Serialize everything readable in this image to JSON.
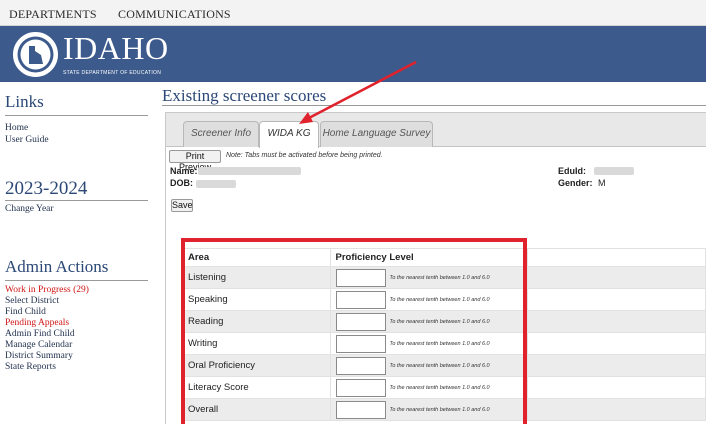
{
  "topnav": {
    "items": [
      "DEPARTMENTS",
      "COMMUNICATIONS"
    ]
  },
  "banner": {
    "brand": "IDAHO",
    "subtitle": "STATE DEPARTMENT OF EDUCATION"
  },
  "sidebar": {
    "links_heading": "Links",
    "links": [
      "Home",
      "User Guide"
    ],
    "year": "2023-2024",
    "change_year": "Change Year",
    "admin_heading": "Admin Actions",
    "admin_items": [
      {
        "label": "Work in Progress (29)",
        "color": "#d01515"
      },
      {
        "label": "Select District",
        "color": "#22324f"
      },
      {
        "label": "Find Child",
        "color": "#22324f"
      },
      {
        "label": "Pending Appeals",
        "color": "#d01515"
      },
      {
        "label": "Admin Find Child",
        "color": "#22324f"
      },
      {
        "label": "Manage Calendar",
        "color": "#22324f"
      },
      {
        "label": "District Summary",
        "color": "#22324f"
      },
      {
        "label": "State Reports",
        "color": "#22324f"
      }
    ]
  },
  "main": {
    "heading": "Existing screener scores",
    "tabs": [
      "Screener Info",
      "WIDA KG",
      "Home Language Survey"
    ],
    "active_tab": "WIDA KG",
    "print_preview_label": "Print Preview",
    "note": "Note: Tabs must be activated before being printed.",
    "name_label": "Name:",
    "dob_label": "DOB:",
    "eduid_label": "EduId:",
    "gender_label": "Gender:",
    "gender_value": "M",
    "save_label": "Save"
  },
  "score_table": {
    "headers": [
      "Area",
      "Proficiency Level"
    ],
    "hint": "To the nearest tenth between 1.0 and 6.0",
    "rows": [
      "Listening",
      "Speaking",
      "Reading",
      "Writing",
      "Oral Proficiency",
      "Literacy Score",
      "Overall"
    ]
  },
  "colors": {
    "banner": "#3c5a8c",
    "heading": "#2b4876",
    "alert": "#d01515",
    "highlight": "#e0222c"
  }
}
